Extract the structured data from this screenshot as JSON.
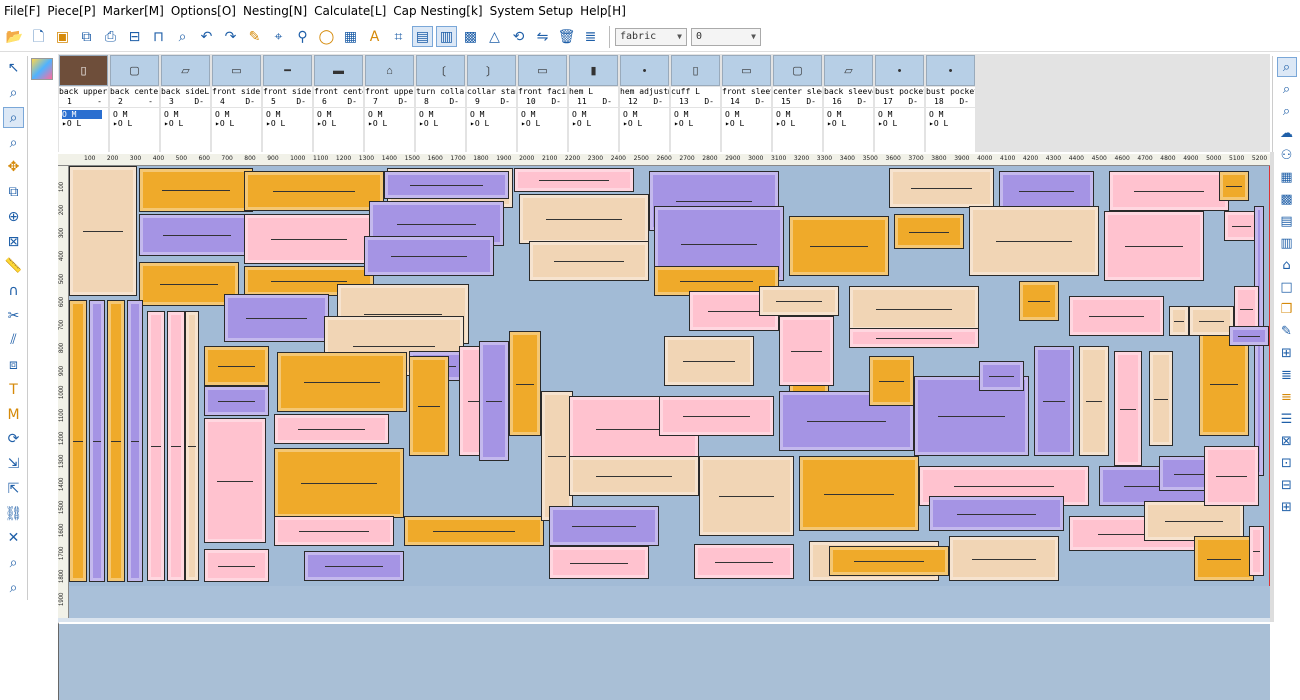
{
  "menu": [
    "File[F]",
    "Piece[P]",
    "Marker[M]",
    "Options[O]",
    "Nesting[N]",
    "Calculate[L]",
    "Cap Nesting[k]",
    "System Setup",
    "Help[H]"
  ],
  "toolbar": {
    "fabric_select": "fabric",
    "number_select": "0"
  },
  "pieces": [
    {
      "name": "back upperL",
      "num": "1",
      "suffix": "-"
    },
    {
      "name": "back centerL",
      "num": "2",
      "suffix": "-"
    },
    {
      "name": "back sideL",
      "num": "3",
      "suffix": "D-"
    },
    {
      "name": "front sideL",
      "num": "4",
      "suffix": "D-"
    },
    {
      "name": "front side c",
      "num": "5",
      "suffix": "D-"
    },
    {
      "name": "front center",
      "num": "6",
      "suffix": "D-"
    },
    {
      "name": "front upperL",
      "num": "7",
      "suffix": "D-"
    },
    {
      "name": "turn collarL",
      "num": "8",
      "suffix": "D-"
    },
    {
      "name": "collar stand",
      "num": "9",
      "suffix": "D-"
    },
    {
      "name": "front facing",
      "num": "10",
      "suffix": "D-"
    },
    {
      "name": "hem      L",
      "num": "11",
      "suffix": "D-"
    },
    {
      "name": "hem adjustme",
      "num": "12",
      "suffix": "D-"
    },
    {
      "name": "cuff     L",
      "num": "13",
      "suffix": "D-"
    },
    {
      "name": "front sleeve",
      "num": "14",
      "suffix": "D-"
    },
    {
      "name": "center sleev",
      "num": "15",
      "suffix": "D-"
    },
    {
      "name": "back sleeveL",
      "num": "16",
      "suffix": "D-"
    },
    {
      "name": "bust pocket",
      "num": "17",
      "suffix": "D-"
    },
    {
      "name": "bust pocketL",
      "num": "18",
      "suffix": "D-"
    }
  ],
  "size_rows": [
    "O M",
    "O L"
  ],
  "ruler_ticks": [
    "100",
    "200",
    "300",
    "400",
    "500",
    "600",
    "700",
    "800",
    "900",
    "1000",
    "1100",
    "1200",
    "1300",
    "1400",
    "1500",
    "1600",
    "1700",
    "1800",
    "1900",
    "2000",
    "2100",
    "2200",
    "2300",
    "2400",
    "2500",
    "2600",
    "2700",
    "2800",
    "2900",
    "3000",
    "3100",
    "3200",
    "3300",
    "3400",
    "3500",
    "3600",
    "3700",
    "3800",
    "3900",
    "4000",
    "4100",
    "4200",
    "4300",
    "4400",
    "4500",
    "4600",
    "4700",
    "4800",
    "4900",
    "5000",
    "5100",
    "5200"
  ],
  "vruler_ticks": [
    "100",
    "200",
    "300",
    "400",
    "500",
    "600",
    "700",
    "800",
    "900",
    "1000",
    "1100",
    "1200",
    "1300",
    "1400",
    "1500",
    "1600",
    "1700",
    "1800",
    "1900"
  ],
  "colors": {
    "yellow": "#efaa2a",
    "pink": "#ffc2cf",
    "violet": "#a594e4",
    "tan": "#f1d5b5",
    "board": "#a2bbd6"
  }
}
